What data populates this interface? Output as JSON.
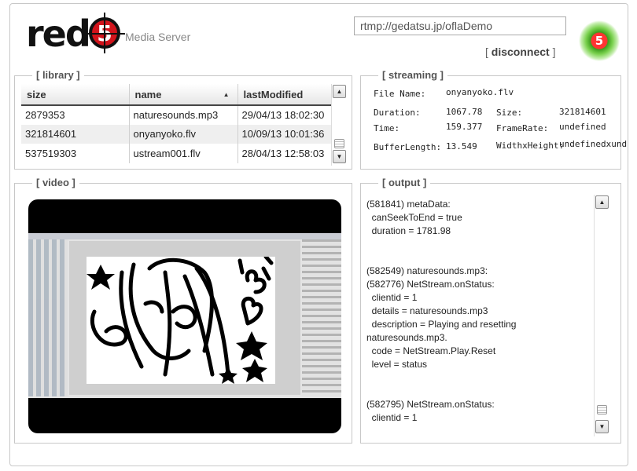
{
  "header": {
    "logo_text": "red",
    "logo_badge": "5",
    "subtitle": "Media Server",
    "url_value": "rtmp://gedatsu.jp/oflaDemo",
    "disconnect_label": "disconnect",
    "bracket_open": "[",
    "bracket_close": "]",
    "status_badge": "5",
    "status_color": "#3d9c1e"
  },
  "library": {
    "legend": "[ library ]",
    "columns": [
      "size",
      "name",
      "lastModified"
    ],
    "sort_column": "name",
    "rows": [
      {
        "size": "2879353",
        "name": "naturesounds.mp3",
        "lastModified": "29/04/13 18:02:30"
      },
      {
        "size": "321814601",
        "name": "onyanyoko.flv",
        "lastModified": "10/09/13 10:01:36"
      },
      {
        "size": "537519303",
        "name": "ustream001.flv",
        "lastModified": "28/04/13 12:58:03"
      }
    ]
  },
  "streaming": {
    "legend": "[ streaming ]",
    "file_name_label": "File Name:",
    "file_name_value": "onyanyoko.flv",
    "duration_label": "Duration:",
    "duration_value": "1067.78",
    "size_label": "Size:",
    "size_value": "321814601",
    "time_label": "Time:",
    "time_value": "159.377",
    "framerate_label": "FrameRate:",
    "framerate_value": "undefined",
    "bufferlength_label": "BufferLength:",
    "bufferlength_value": "13.549",
    "wxh_label": "WidthxHeight:",
    "wxh_value": "undefinedxund"
  },
  "video": {
    "legend": "[ video ]"
  },
  "output": {
    "legend": "[ output ]",
    "log": "(581841) metaData:\n  canSeekToEnd = true\n  duration = 1781.98\n\n\n(582549) naturesounds.mp3:\n(582776) NetStream.onStatus:\n  clientid = 1\n  details = naturesounds.mp3\n  description = Playing and resetting\nnaturesounds.mp3.\n  code = NetStream.Play.Reset\n  level = status\n\n\n(582795) NetStream.onStatus:\n  clientid = 1"
  },
  "icons": {
    "scroll_up": "▲",
    "scroll_down": "▼",
    "sort_asc": "▲"
  }
}
